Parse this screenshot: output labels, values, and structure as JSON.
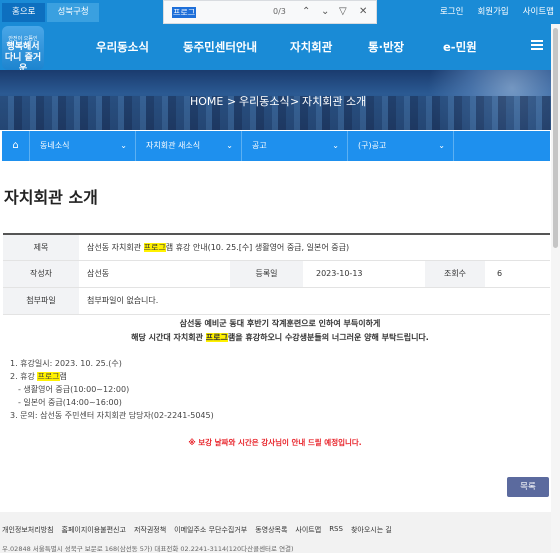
{
  "topbar": {
    "home": "홈으로",
    "guchung": "성북구청",
    "login": "로그인",
    "join": "회원가입",
    "sitemap": "사이트맵"
  },
  "findbar": {
    "query": "프로그",
    "count": "0/3"
  },
  "logo": {
    "small": "안전이 으뜸인",
    "text1": "행복해서",
    "text2": "다니",
    "text3": "즐거운"
  },
  "gnb": [
    "우리동소식",
    "동주민센터안내",
    "자치회관",
    "통·반장",
    "e-민원"
  ],
  "breadcrumb": {
    "home": "HOME",
    "sep": ">",
    "l1": "우리동소식",
    "l2": "자치회관 소개"
  },
  "subnav": [
    "동네소식",
    "자치회관 새소식",
    "공고",
    "(구)공고"
  ],
  "page_title": "자치회관 소개",
  "info": {
    "title_label": "제목",
    "title_pre": "삼선동 자치회관 ",
    "title_hl": "프로그",
    "title_post": "램 휴강 안내(10. 25.[수] 생활영어 중급, 일본어 중급)",
    "author_label": "작성자",
    "author": "삼선동",
    "date_label": "등록일",
    "date": "2023-10-13",
    "views_label": "조회수",
    "views": "6",
    "attach_label": "첨부파일",
    "attach": "첨부파일이 없습니다."
  },
  "content": {
    "notice1": "삼선동 예비군 동대 후반기 작계훈련으로 인하여 부득이하게",
    "notice2_pre": "해당 시간대 자치회관 ",
    "notice2_hl": "프로그",
    "notice2_post": "램을 휴강하오니 수강생분들의 너그러운 양해 부탁드립니다.",
    "item1": "1. 휴강일시: 2023. 10. 25.(수)",
    "item2_pre": "2. 휴강 ",
    "item2_hl": "프로그",
    "item2_post": "램",
    "item2a": "- 생활영어 중급(10:00~12:00)",
    "item2b": "- 일본어 중급(14:00~16:00)",
    "item3": "3. 문의: 삼선동 주민센터 자치회관 담당자(02-2241-5045)",
    "red": "※ 보강 날짜와 시간은 강사님이 안내 드릴 예정입니다."
  },
  "list_button": "목록",
  "footer": {
    "links": [
      "개인정보처리방침",
      "홈페이지이용불편신고",
      "저작권정책",
      "이메일주소 무단수집거부",
      "동영상목록",
      "사이트맵",
      "RSS",
      "찾아오시는 길"
    ],
    "address": "우.02848 서울특별시 성북구 보문로 168(삼선동 5가) 대표전화 02.2241-3114(120다산콜센터로 연결)"
  }
}
